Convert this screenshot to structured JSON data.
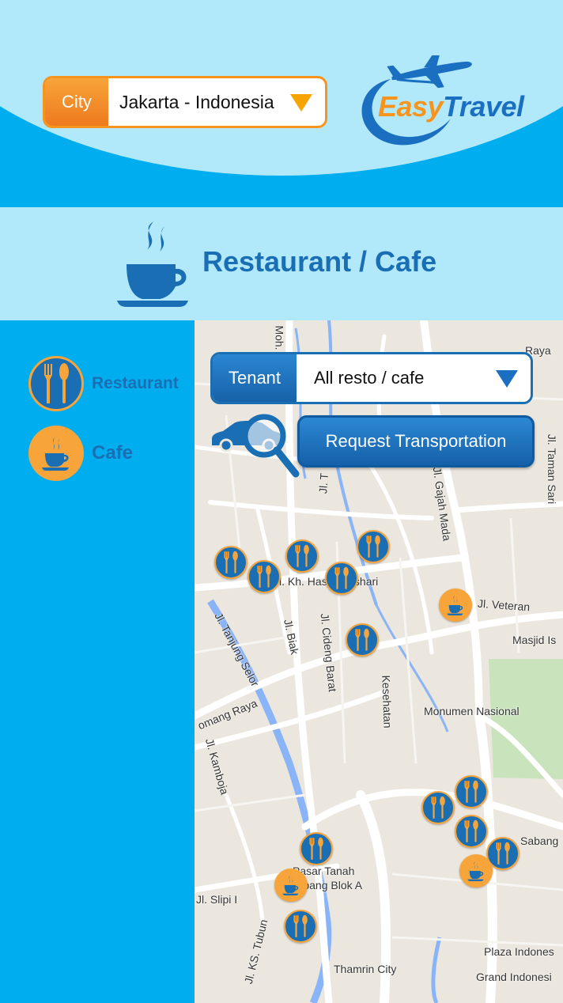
{
  "header": {
    "city_label": "City",
    "city_value": "Jakarta - Indonesia",
    "logo_easy": "Easy",
    "logo_travel": "Travel"
  },
  "title": {
    "text": "Restaurant / Cafe",
    "icon": "coffee-cup-icon"
  },
  "sidebar": {
    "items": [
      {
        "label": "Restaurant",
        "icon": "fork-knife-icon"
      },
      {
        "label": "Cafe",
        "icon": "coffee-cup-icon"
      }
    ]
  },
  "map": {
    "tenant_label": "Tenant",
    "tenant_value": "All resto / cafe",
    "transport_button": "Request Transportation",
    "transport_icon": "car-search-icon",
    "street_labels": {
      "raya": "Raya",
      "moh": "Moh.",
      "taman_sari": "Jl. Taman Sari",
      "gajah_mada": "Jl. Gajah Mada",
      "jl_t": "Jl. T",
      "kyai_ashari": "Jl. Kh. Hasyim Ashari",
      "veteran": "Jl. Veteran",
      "masjid": "Masjid Is",
      "tanjung_selor": "Jl. Tanjung Selor",
      "biak": "Jl. Biak",
      "cideng_barat": "Jl. Cideng Barat",
      "kesehatan": "Kesehatan",
      "monumen": "Monumen Nasional",
      "pomang_raya": "omang Raya",
      "kamboja": "Jl. Kamboja",
      "sabang": "Sabang",
      "pasar": "Pasar Tanah",
      "abang": "Abang Blok A",
      "slipi": "Jl. Slipi I",
      "ks_tubun": "Jl. KS. Tubun",
      "plaza": "Plaza Indones",
      "thamrin": "Thamrin City",
      "grand": "Grand Indonesi"
    },
    "colors": {
      "road": "#ffffff",
      "water": "#8ab4f8",
      "park": "#c9e3bc",
      "land": "#ebe6de"
    }
  },
  "colors": {
    "primary_blue": "#1a6fb4",
    "accent_orange": "#f7a43a",
    "sky": "#b2e9fa",
    "bright_blue": "#00aeef"
  }
}
